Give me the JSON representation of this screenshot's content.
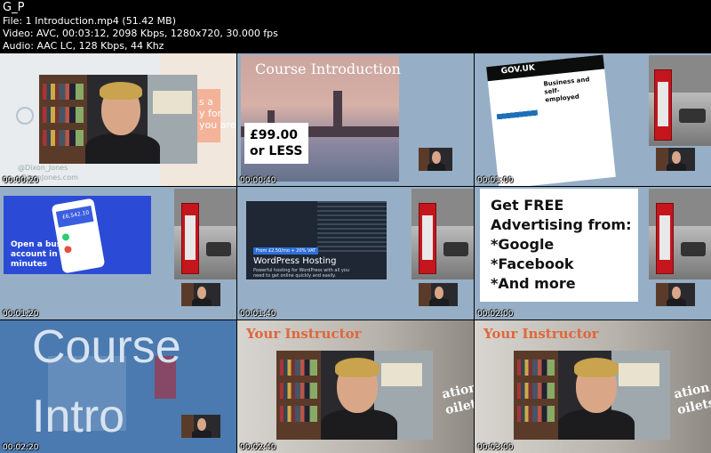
{
  "header": {
    "title": "G_P",
    "file_line": "File: 1  Introduction.mp4 (51.42 MB)",
    "video_line": "Video: AVC, 00:03:12, 2098 Kbps, 1280x720, 30.000 fps",
    "audio_line": "Audio: AAC LC, 128 Kbps, 44 Khz"
  },
  "tiles": [
    {
      "timestamp": "00:00:20",
      "watermark_1": "@Dixon_Jones",
      "watermark_2": "DixonJones.com",
      "bg_text_1": "s a",
      "bg_text_2": "y for",
      "bg_text_3": "you are"
    },
    {
      "timestamp": "00:00:40",
      "heading": "Course Introduction",
      "price_1": "£99.00",
      "price_2": "or LESS"
    },
    {
      "timestamp": "00:01:00",
      "brand": "GOV.UK",
      "panel_title_1": "Business and self-",
      "panel_title_2": "employed"
    },
    {
      "timestamp": "00:01:20",
      "banner_1": "Open a business",
      "banner_2": "account in",
      "banner_3": "minutes",
      "phone_value": "£6,542.10"
    },
    {
      "timestamp": "00:01:40",
      "badge": "From £2.50/mo + 20% VAT",
      "product": "WordPress Hosting",
      "desc_1": "Powerful hosting for WordPress with all you",
      "desc_2": "need to get online quickly and easily."
    },
    {
      "timestamp": "00:02:00",
      "lines": [
        "Get FREE",
        "Advertising from:",
        "*Google",
        "*Facebook",
        "*And more"
      ]
    },
    {
      "timestamp": "00:02:20",
      "word_1": "Course",
      "word_2": "Intro"
    },
    {
      "timestamp": "00:02:40",
      "heading": "Your Instructor",
      "side_1": "ation",
      "side_2": "oilets"
    },
    {
      "timestamp": "00:03:00",
      "heading": "Your Instructor",
      "side_1": "ation",
      "side_2": "oilets"
    }
  ],
  "colors": {
    "slate_blue": "#96afc6",
    "bbc_blue": "#2b4bd6",
    "steel_blue": "#4a7ab0",
    "instructor_orange": "#e0673a"
  }
}
